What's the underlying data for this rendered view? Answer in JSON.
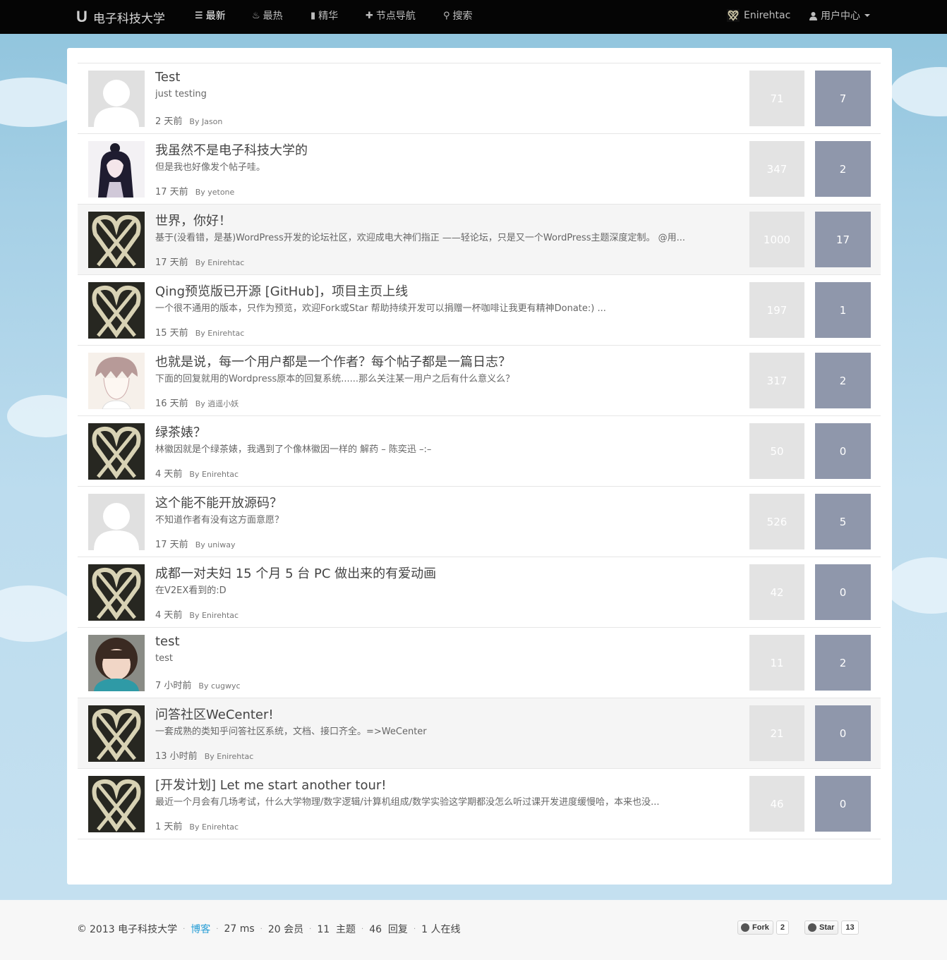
{
  "nav": {
    "brand_logo": "U",
    "brand_name": "电子科技大学",
    "items": [
      {
        "icon": "list-icon",
        "glyph": "☰",
        "label": "最新"
      },
      {
        "icon": "fire-icon",
        "glyph": "♨",
        "label": "最热"
      },
      {
        "icon": "bookmark-icon",
        "glyph": "▮",
        "label": "精华"
      },
      {
        "icon": "plus-icon",
        "glyph": "✚",
        "label": "节点导航"
      },
      {
        "icon": "search-icon",
        "glyph": "⚲",
        "label": "搜索"
      }
    ],
    "username": "Enirehtac",
    "user_menu_label": "用户中心"
  },
  "topics": [
    {
      "title": "Test",
      "excerpt": "just testing",
      "time": "2 天前",
      "author": "By Jason",
      "views": "71",
      "replies": "7",
      "avatar": "default"
    },
    {
      "title": "我虽然不是电子科技大学的",
      "excerpt": "但是我也好像发个帖子哇。",
      "time": "17 天前",
      "author": "By yetone",
      "views": "347",
      "replies": "2",
      "avatar": "anime"
    },
    {
      "title": "世界，你好！",
      "excerpt": "基于(没看错，是基)WordPress开发的论坛社区，欢迎成电大神们指正 ——轻论坛，只是又一个WordPress主题深度定制。 @用...",
      "time": "17 天前",
      "author": "By Enirehtac",
      "views": "1000",
      "replies": "17",
      "avatar": "heart"
    },
    {
      "title": "Qing预览版已开源 [GitHub]，项目主页上线",
      "excerpt": "一个很不通用的版本，只作为预览，欢迎Fork或Star   帮助持续开发可以捐赠一杯咖啡让我更有精神Donate:) ...",
      "time": "15 天前",
      "author": "By Enirehtac",
      "views": "197",
      "replies": "1",
      "avatar": "heart"
    },
    {
      "title": "也就是说，每一个用户都是一个作者？每个帖子都是一篇日志？",
      "excerpt": "下面的回复就用的Wordpress原本的回复系统......那么关注某一用户之后有什么意义么？",
      "time": "16 天前",
      "author": "By 逍遥小妖",
      "views": "317",
      "replies": "2",
      "avatar": "sketch"
    },
    {
      "title": "绿茶婊？",
      "excerpt": "林徽因就是个绿茶婊，我遇到了个像林徽因一样的 解药 – 陈奕迅 –:–",
      "time": "4 天前",
      "author": "By Enirehtac",
      "views": "50",
      "replies": "0",
      "avatar": "heart"
    },
    {
      "title": "这个能不能开放源码？",
      "excerpt": "不知道作者有没有这方面意愿？",
      "time": "17 天前",
      "author": "By uniway",
      "views": "526",
      "replies": "5",
      "avatar": "default"
    },
    {
      "title": "成都一对夫妇 15 个月 5 台 PC 做出来的有爱动画",
      "excerpt": "在V2EX看到的:D",
      "time": "4 天前",
      "author": "By Enirehtac",
      "views": "42",
      "replies": "0",
      "avatar": "heart"
    },
    {
      "title": "test",
      "excerpt": "test",
      "time": "7 小时前",
      "author": "By cugwyc",
      "views": "11",
      "replies": "2",
      "avatar": "child"
    },
    {
      "title": "问答社区WeCenter!",
      "excerpt": "一套成熟的类知乎问答社区系统，文档、接口齐全。=>WeCenter",
      "time": "13 小时前",
      "author": "By Enirehtac",
      "views": "21",
      "replies": "0",
      "avatar": "heart"
    },
    {
      "title": "[开发计划] Let me start another tour!",
      "excerpt": "最近一个月会有几场考试，什么大学物理/数字逻辑/计算机组成/数学实验这学期都没怎么听过课开发进度缓慢哈，本来也没...",
      "time": "1 天前",
      "author": "By Enirehtac",
      "views": "46",
      "replies": "0",
      "avatar": "heart"
    }
  ],
  "footer": {
    "copyright_symbol": "©",
    "copyright": "2013 电子科技大学",
    "blog_link": "博客",
    "timing": "27 ms",
    "members": "20 会员",
    "topics": "11  主题",
    "replies": "46  回复",
    "online": "1 人在线",
    "fork_label": "Fork",
    "fork_count": "2",
    "star_label": "Star",
    "star_count": "13"
  },
  "colors": {
    "navbar": "#050505",
    "views_box": "#e3e3e3",
    "replies_box": "#8f97ab",
    "link": "#2a9fd6"
  }
}
